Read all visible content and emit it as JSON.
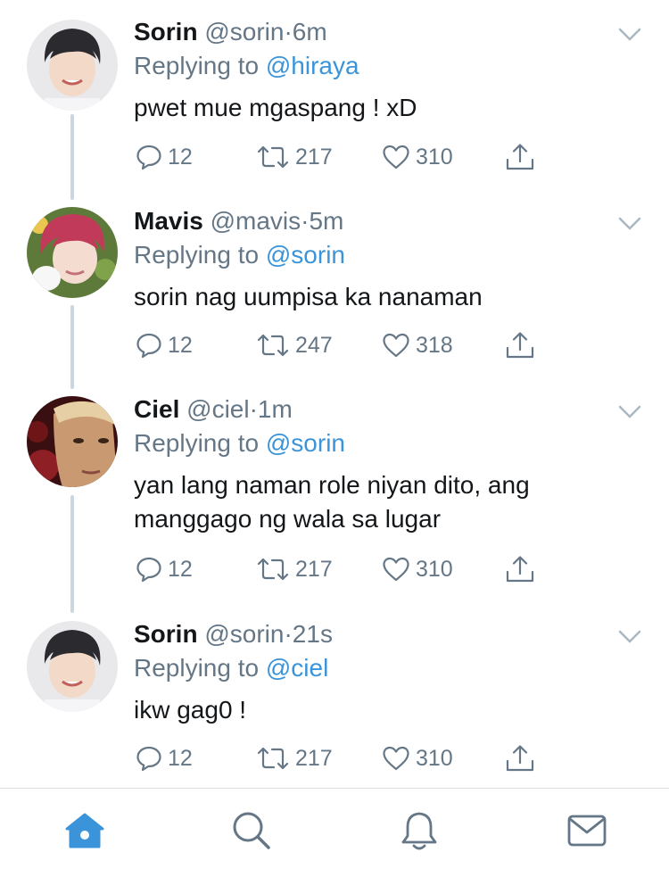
{
  "tweets": [
    {
      "name": "Sorin",
      "handle": "@sorin",
      "dot": "·",
      "time": "6m",
      "replying_prefix": "Replying to",
      "replying_to": "@hiraya",
      "text": "pwet mue mgaspang ! xD",
      "replies": "12",
      "retweets": "217",
      "likes": "310"
    },
    {
      "name": "Mavis",
      "handle": "@mavis",
      "dot": "·",
      "time": "5m",
      "replying_prefix": "Replying to",
      "replying_to": "@sorin",
      "text": "sorin nag uumpisa ka nanaman",
      "replies": "12",
      "retweets": "247",
      "likes": "318"
    },
    {
      "name": "Ciel",
      "handle": "@ciel",
      "dot": "·",
      "time": "1m",
      "replying_prefix": "Replying to",
      "replying_to": "@sorin",
      "text_line1": "yan lang naman role niyan dito, ang",
      "text_line2": "manggago ng wala sa lugar",
      "replies": "12",
      "retweets": "217",
      "likes": "310"
    },
    {
      "name": "Sorin",
      "handle": "@sorin",
      "dot": "·",
      "time": "21s",
      "replying_prefix": "Replying to",
      "replying_to": "@ciel",
      "text": "ikw gag0 !",
      "replies": "12",
      "retweets": "217",
      "likes": "310"
    }
  ],
  "tabbar": {
    "items": [
      "home-icon",
      "search-icon",
      "notifications-icon",
      "messages-icon"
    ],
    "active": "home-icon",
    "active_color": "#3b94d9",
    "inactive_color": "#657786"
  },
  "colors": {
    "link": "#3b94d9",
    "secondary_text": "#657786",
    "thread_line": "#ccd6dd"
  }
}
